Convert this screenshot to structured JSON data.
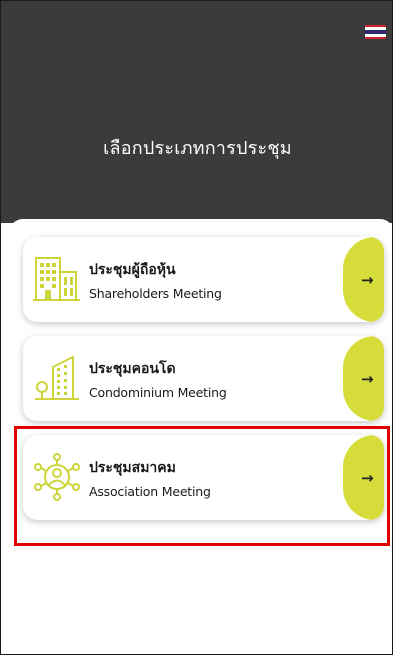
{
  "header": {
    "title": "เลือกประเภทการประชุม",
    "language_flag": "thai-flag-icon"
  },
  "meetings": [
    {
      "title_th": "ประชุมผู้ถือหุ้น",
      "title_en": "Shareholders Meeting",
      "icon": "office-building-icon",
      "arrow": "→"
    },
    {
      "title_th": "ประชุมคอนโด",
      "title_en": "Condominium Meeting",
      "icon": "condominium-tower-icon",
      "arrow": "→"
    },
    {
      "title_th": "ประชุมสมาคม",
      "title_en": "Association Meeting",
      "icon": "people-network-icon",
      "arrow": "→"
    }
  ],
  "colors": {
    "header_bg": "#3b3b3b",
    "accent": "#d6dd3a",
    "icon_line": "#cdd538",
    "highlight": "#e00000",
    "flag_red": "#d81f2a",
    "flag_white": "#ffffff",
    "flag_blue": "#2d2a76"
  }
}
